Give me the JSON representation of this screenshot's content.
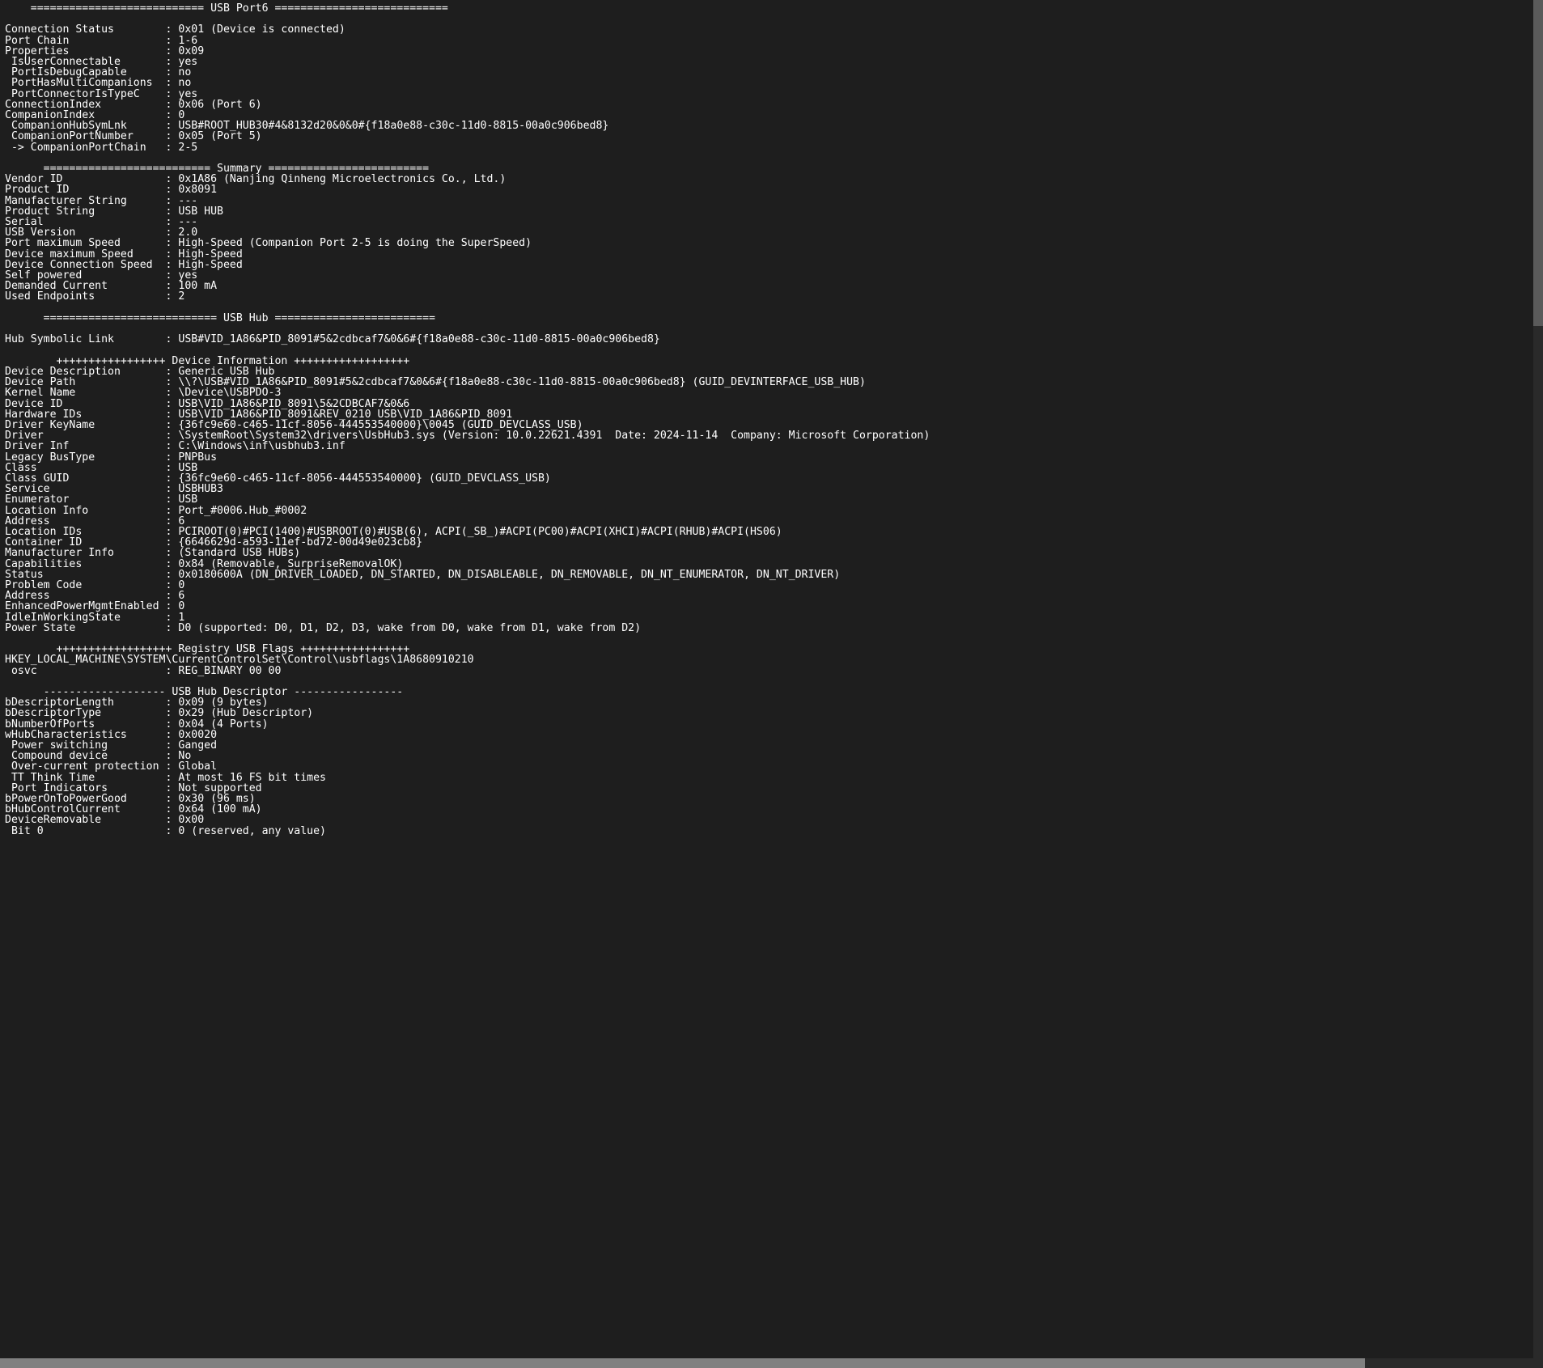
{
  "headers": {
    "port6": "    =========================== USB Port6 ===========================",
    "summary": "      ========================== Summary =========================",
    "usb_hub": "      =========================== USB Hub =========================",
    "device_info": "        +++++++++++++++++ Device Information ++++++++++++++++++",
    "registry": "        ++++++++++++++++++ Registry USB Flags +++++++++++++++++",
    "hub_desc": "      ------------------- USB Hub Descriptor -----------------"
  },
  "port": {
    "connection_status": "0x01 (Device is connected)",
    "port_chain": "1-6",
    "properties": "0x09",
    "is_user_connectable": "yes",
    "port_is_debug_capable": "no",
    "port_has_multi_companions": "no",
    "port_connector_is_type_c": "yes",
    "connection_index": "0x06 (Port 6)",
    "companion_index": "0",
    "companion_hub_sym_lnk": "USB#ROOT_HUB30#4&8132d20&0&0#{f18a0e88-c30c-11d0-8815-00a0c906bed8}",
    "companion_port_number": "0x05 (Port 5)",
    "companion_port_chain": "2-5"
  },
  "summary": {
    "vendor_id": "0x1A86 (Nanjing Qinheng Microelectronics Co., Ltd.)",
    "product_id": "0x8091",
    "manufacturer_string": "---",
    "product_string": "USB HUB",
    "serial": "---",
    "usb_version": "2.0",
    "port_maximum_speed": "High-Speed (Companion Port 2-5 is doing the SuperSpeed)",
    "device_maximum_speed": "High-Speed",
    "device_connection_speed": "High-Speed",
    "self_powered": "yes",
    "demanded_current": "100 mA",
    "used_endpoints": "2"
  },
  "hub": {
    "symbolic_link": "USB#VID_1A86&PID_8091#5&2cdbcaf7&0&6#{f18a0e88-c30c-11d0-8815-00a0c906bed8}"
  },
  "devinfo": {
    "device_description": "Generic USB Hub",
    "device_path": "\\\\?\\USB#VID_1A86&PID_8091#5&2cdbcaf7&0&6#{f18a0e88-c30c-11d0-8815-00a0c906bed8} (GUID_DEVINTERFACE_USB_HUB)",
    "kernel_name": "\\Device\\USBPDO-3",
    "device_id": "USB\\VID_1A86&PID_8091\\5&2CDBCAF7&0&6",
    "hardware_ids": "USB\\VID_1A86&PID_8091&REV_0210 USB\\VID_1A86&PID_8091",
    "driver_keyname": "{36fc9e60-c465-11cf-8056-444553540000}\\0045 (GUID_DEVCLASS_USB)",
    "driver": "\\SystemRoot\\System32\\drivers\\UsbHub3.sys (Version: 10.0.22621.4391  Date: 2024-11-14  Company: Microsoft Corporation)",
    "driver_inf": "C:\\Windows\\inf\\usbhub3.inf",
    "legacy_bustype": "PNPBus",
    "class": "USB",
    "class_guid": "{36fc9e60-c465-11cf-8056-444553540000} (GUID_DEVCLASS_USB)",
    "service": "USBHUB3",
    "enumerator": "USB",
    "location_info": "Port_#0006.Hub_#0002",
    "address": "6",
    "location_ids": "PCIROOT(0)#PCI(1400)#USBROOT(0)#USB(6), ACPI(_SB_)#ACPI(PC00)#ACPI(XHCI)#ACPI(RHUB)#ACPI(HS06)",
    "container_id": "{6646629d-a593-11ef-bd72-00d49e023cb8}",
    "manufacturer_info": "(Standard USB HUBs)",
    "capabilities": "0x84 (Removable, SurpriseRemovalOK)",
    "status": "0x0180600A (DN_DRIVER_LOADED, DN_STARTED, DN_DISABLEABLE, DN_REMOVABLE, DN_NT_ENUMERATOR, DN_NT_DRIVER)",
    "problem_code": "0",
    "address2": "6",
    "enhanced_power_mgmt_enabled": "0",
    "idle_in_working_state": "1",
    "power_state": "D0 (supported: D0, D1, D2, D3, wake from D0, wake from D1, wake from D2)"
  },
  "registry": {
    "path": "HKEY_LOCAL_MACHINE\\SYSTEM\\CurrentControlSet\\Control\\usbflags\\1A8680910210",
    "osvc": "REG_BINARY 00 00"
  },
  "desc": {
    "bDescriptorLength": "0x09 (9 bytes)",
    "bDescriptorType": "0x29 (Hub Descriptor)",
    "bNumberOfPorts": "0x04 (4 Ports)",
    "wHubCharacteristics": "0x0020",
    "power_switching": "Ganged",
    "compound_device": "No",
    "over_current_protection": "Global",
    "tt_think_time": "At most 16 FS bit times",
    "port_indicators": "Not supported",
    "bPowerOnToPowerGood": "0x30 (96 ms)",
    "bHubControlCurrent": "0x64 (100 mA)",
    "DeviceRemovable": "0x00",
    "bit0": "0 (reserved, any value)"
  }
}
